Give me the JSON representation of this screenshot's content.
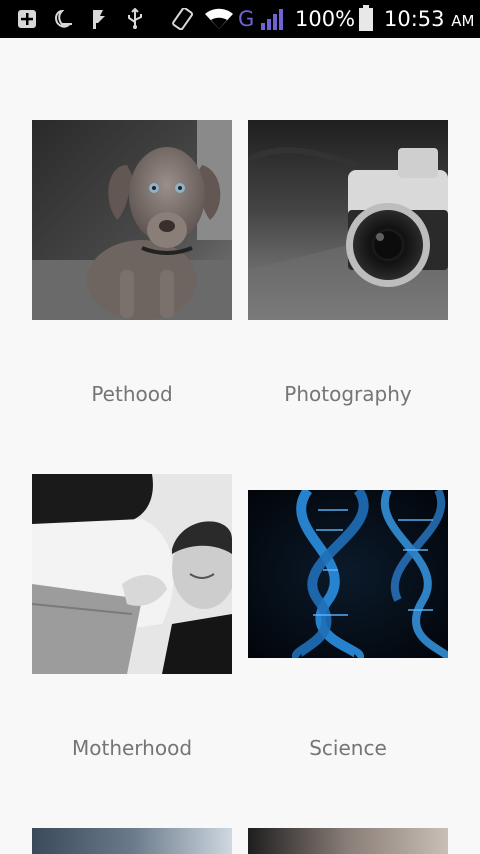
{
  "status_bar": {
    "battery_percent": "100%",
    "time": "10:53",
    "ampm": "AM",
    "network_type": "G",
    "icons": [
      "add-box-icon",
      "moon-icon",
      "flag-icon",
      "usb-icon",
      "screen-rotation-icon",
      "wifi-icon",
      "signal-icon",
      "battery-icon"
    ]
  },
  "categories": [
    {
      "label": "Pethood",
      "image": "dog-photo"
    },
    {
      "label": "Photography",
      "image": "camera-photo"
    },
    {
      "label": "Motherhood",
      "image": "couple-belly-photo"
    },
    {
      "label": "Science",
      "image": "dna-helix-photo"
    }
  ],
  "colors": {
    "background": "#f8f8f8",
    "status_bar": "#000000",
    "label_text": "#757575",
    "network_accent": "#6f63d6"
  }
}
